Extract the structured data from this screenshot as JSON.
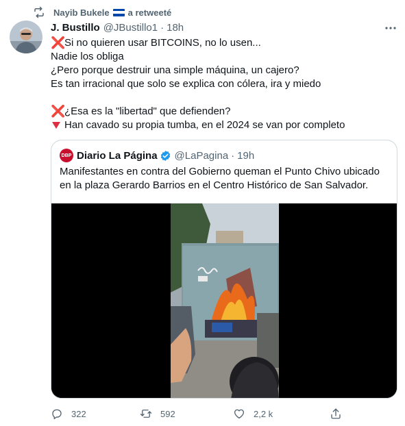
{
  "retweet": {
    "user": "Nayib Bukele",
    "suffix": "a retweeté",
    "flag_colors": [
      "#0047ab",
      "#ffffff",
      "#0047ab"
    ]
  },
  "tweet": {
    "name": "J. Bustillo",
    "handle": "@JBustillo1",
    "separator": "·",
    "time": "18h",
    "line1": "Si no quieren usar BITCOINS, no lo usen...",
    "line2": "Nadie los obliga",
    "line3": "¿Pero porque destruir una simple máquina, un cajero?",
    "line4": "Es tan irracional que solo se explica con cólera, ira y miedo",
    "line5": "¿Esa es la \"libertad\" que defienden?",
    "line6": "Han cavado su propia tumba, en el 2024 se van por completo",
    "cross_emoji": "❌",
    "accent_red": "#dd2e44"
  },
  "quote": {
    "avatar_text": "DBP",
    "name": "Diario La Página",
    "handle": "@LaPagina",
    "separator": "·",
    "time": "19h",
    "text": "Manifestantes en contra del Gobierno queman el Punto Chivo ubicado en la plaza Gerardo Barrios en el Centro Histórico de San Salvador.",
    "verified_color": "#1d9bf0",
    "brand_color": "#c8102e"
  },
  "actions": {
    "reply_count": "322",
    "retweet_count": "592",
    "like_count": "2,2 k",
    "icons": [
      "reply-icon",
      "retweet-icon",
      "like-icon",
      "share-icon"
    ]
  }
}
